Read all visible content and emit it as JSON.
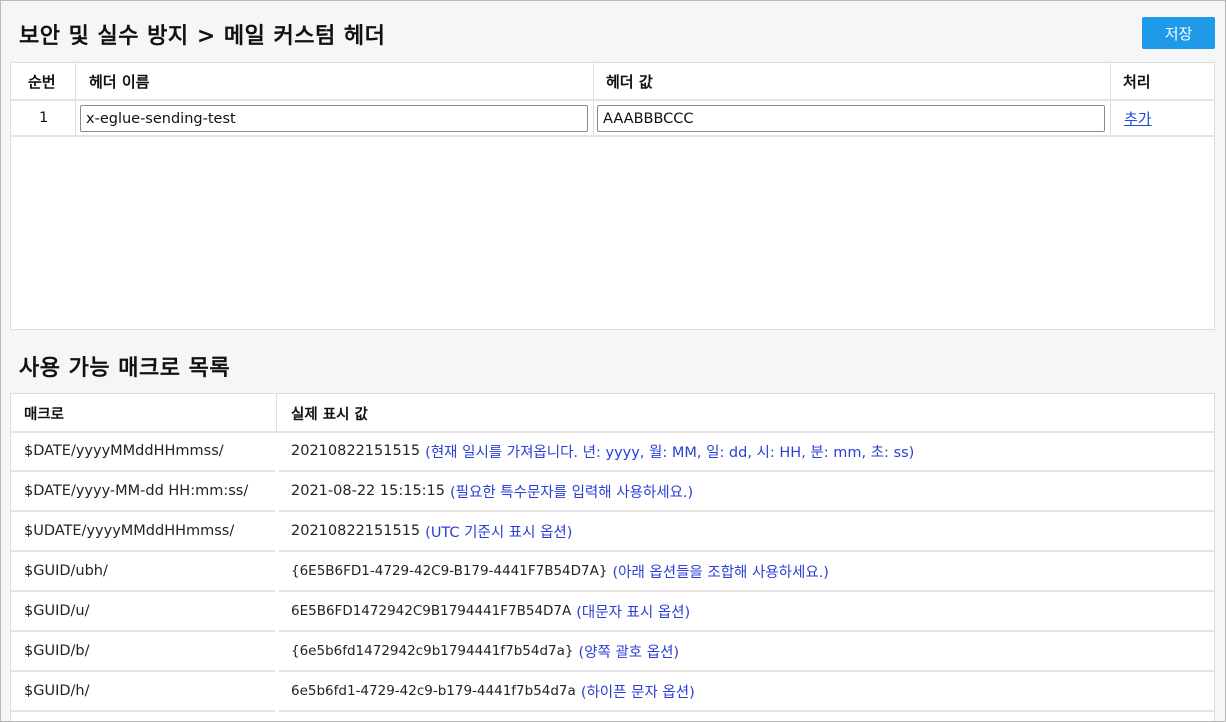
{
  "page": {
    "title": "보안 및 실수 방지 > 메일 커스텀 헤더",
    "save_label": "저장",
    "accent_color": "#1e9ae8",
    "link_color": "#1a4fd6"
  },
  "header_table": {
    "columns": [
      "순번",
      "헤더 이름",
      "헤더 값",
      "처리"
    ],
    "rows": [
      {
        "index": "1",
        "name": "x-eglue-sending-test",
        "value": "AAABBBCCC",
        "action": "추가"
      }
    ]
  },
  "macro_section": {
    "title": "사용 가능 매크로 목록",
    "columns": [
      "매크로",
      "실제 표시 값"
    ],
    "rows": [
      {
        "macro": "$DATE/yyyyMMddHHmmss/",
        "value": "20210822151515",
        "note": "(현재 일시를 가져옵니다. 년: yyyy, 월: MM, 일: dd, 시: HH, 분: mm, 초: ss)"
      },
      {
        "macro": "$DATE/yyyy-MM-dd HH:mm:ss/",
        "value": "2021-08-22 15:15:15",
        "note": "(필요한 특수문자를 입력해 사용하세요.)"
      },
      {
        "macro": "$UDATE/yyyyMMddHHmmss/",
        "value": "20210822151515",
        "note": "(UTC 기준시 표시 옵션)"
      },
      {
        "macro": "$GUID/ubh/",
        "value": "{6E5B6FD1-4729-42C9-B179-4441F7B54D7A}",
        "note": "(아래 옵션들을 조합해 사용하세요.)"
      },
      {
        "macro": "$GUID/u/",
        "value": "6E5B6FD1472942C9B1794441F7B54D7A",
        "note": "(대문자 표시 옵션)"
      },
      {
        "macro": "$GUID/b/",
        "value": "{6e5b6fd1472942c9b1794441f7b54d7a}",
        "note": "(양쪽 괄호 옵션)"
      },
      {
        "macro": "$GUID/h/",
        "value": "6e5b6fd1-4729-42c9-b179-4441f7b54d7a",
        "note": "(하이픈 문자 옵션)"
      }
    ]
  }
}
